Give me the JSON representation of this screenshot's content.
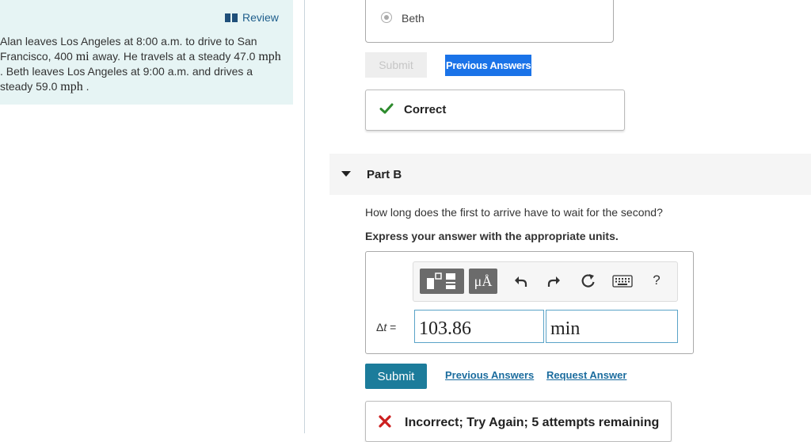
{
  "review": {
    "label": "Review",
    "icon": "book-icon"
  },
  "problem": {
    "part1": "Alan leaves Los Angeles at 8:00 a.m. to drive to San Francisco, 400 ",
    "unit_mi": "mi",
    "part2": " away. He travels at a steady 47.0 ",
    "unit_mph_1": "mph",
    "part3": " . Beth leaves Los Angeles at 9:00 a.m. and drives a steady 59.0 ",
    "unit_mph_2": "mph",
    "part4": " ."
  },
  "part_a": {
    "selected_option": "Beth",
    "submit_label": "Submit",
    "previous_answers_label": "Previous Answers",
    "feedback": "Correct"
  },
  "part_b": {
    "title": "Part B",
    "question": "How long does the first to arrive have to wait for the second?",
    "instruction": "Express your answer with the appropriate units.",
    "toolbar": {
      "units_label": "μÅ",
      "help_label": "?"
    },
    "delta_symbol": "Δ",
    "delta_var": "t",
    "delta_eq": " =",
    "value": "103.86",
    "unit": "min",
    "submit_label": "Submit",
    "previous_answers_label": "Previous Answers",
    "request_answer_label": "Request Answer",
    "feedback": "Incorrect; Try Again; 5 attempts remaining"
  },
  "colors": {
    "accent": "#1c7c9b",
    "correct": "#2e8b2e",
    "incorrect": "#cc1f1f",
    "panel_bg": "#e6f4f4"
  }
}
